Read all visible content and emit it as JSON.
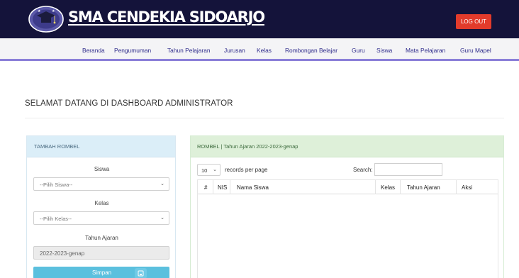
{
  "header": {
    "school_name": "SMA CENDEKIA SIDOARJO",
    "logout_label": "LOG OUT",
    "logout_color": "#e23b2b",
    "bar_color": "#14133a"
  },
  "nav": {
    "items": [
      "Beranda",
      "Pengumuman",
      "Tahun Pelajaran",
      "Jurusan",
      "Kelas",
      "Rombongan Belajar",
      "Guru",
      "Siswa",
      "Mata Pelajaran",
      "Guru Mapel"
    ],
    "accent": "#8b7fd8"
  },
  "page": {
    "welcome": "SELAMAT DATANG DI DASHBOARD ADMINISTRATOR"
  },
  "form": {
    "title": "TAMBAH ROMBEL",
    "siswa_label": "Siswa",
    "siswa_selected": "--Pilih Siswa--",
    "kelas_label": "Kelas",
    "kelas_selected": "--Pilih Kelas--",
    "tahun_label": "Tahun Ajaran",
    "tahun_value": "2022-2023-genap",
    "save_label": "Simpan",
    "save_icon": "save-icon"
  },
  "table": {
    "title": "ROMBEL | Tahun Ajaran 2022-2023-genap",
    "page_length": "10",
    "records_label": "records per page",
    "search_label": "Search:",
    "columns": [
      "#",
      "NIS",
      "Nama Siswa",
      "Kelas",
      "Tahun Ajaran",
      "Aksi"
    ],
    "rows": []
  }
}
